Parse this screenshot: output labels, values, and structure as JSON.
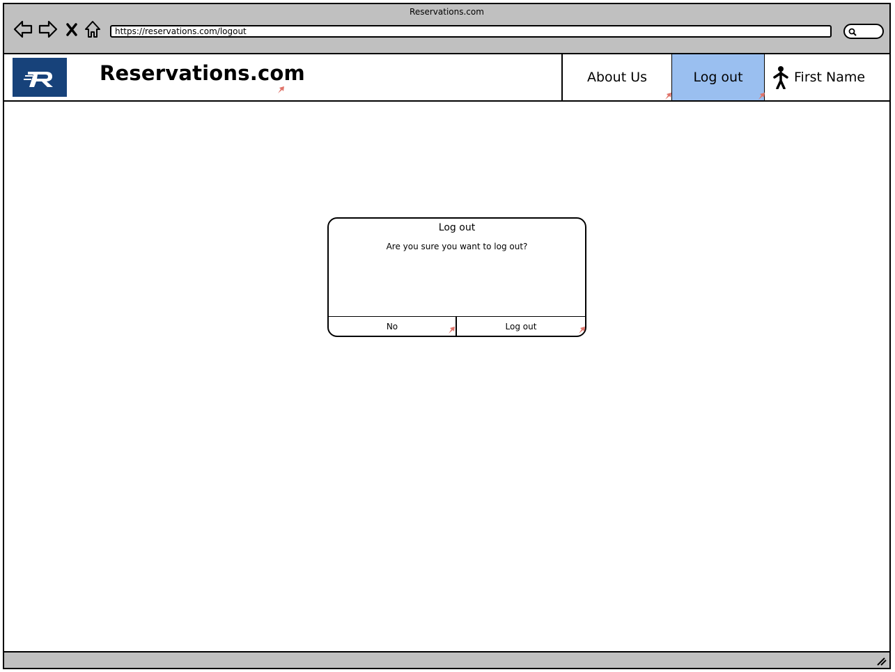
{
  "browser": {
    "window_title": "Reservations.com",
    "address": "https://reservations.com/logout",
    "icons": [
      "back-arrow-icon",
      "forward-arrow-icon",
      "close-icon",
      "home-icon",
      "search-icon"
    ]
  },
  "header": {
    "site_title": "Reservations.com",
    "logo_icon": "reservations-logo",
    "logo_color": "#17427a",
    "nav": {
      "about_label": "About Us",
      "logout_label": "Log out",
      "user_label": "First Name",
      "user_icon": "person-icon",
      "active_color": "#9abff0"
    }
  },
  "dialog": {
    "title": "Log out",
    "message": "Are you sure you want to log out?",
    "no_label": "No",
    "confirm_label": "Log out"
  },
  "colors": {
    "chrome": "#c0c0c0",
    "link_marker": "#e0746a"
  }
}
